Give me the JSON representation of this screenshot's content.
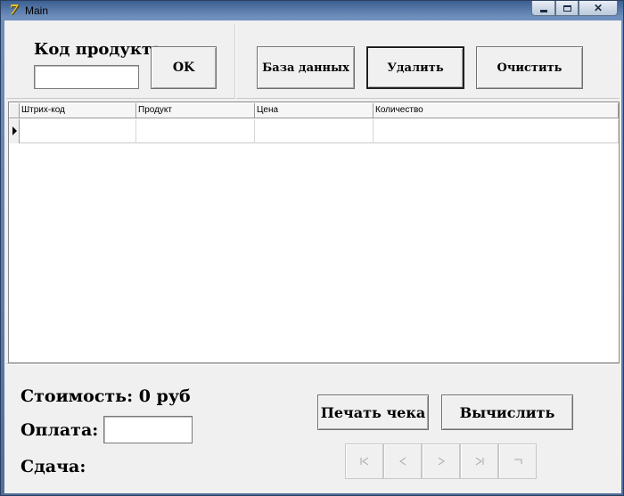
{
  "window": {
    "title": "Main",
    "app_icon_glyph": "7"
  },
  "top": {
    "code_label": "Код продукта",
    "code_value": "",
    "ok_label": "OK",
    "database_label": "База данных",
    "delete_label": "Удалить",
    "clear_label": "Очистить"
  },
  "grid": {
    "columns": [
      "Штрих-код",
      "Продукт",
      "Цена",
      "Количество"
    ],
    "rows": [
      [
        "",
        "",
        "",
        ""
      ]
    ]
  },
  "bottom": {
    "cost_label": "Стоимость: 0 руб",
    "payment_label": "Оплата:",
    "payment_value": "",
    "change_label": "Сдача:",
    "print_label": "Печать чека",
    "calculate_label": "Вычислить"
  },
  "navigator": {
    "buttons": [
      "first-icon",
      "prior-icon",
      "next-icon",
      "last-icon",
      "post-icon"
    ],
    "enabled": false
  }
}
